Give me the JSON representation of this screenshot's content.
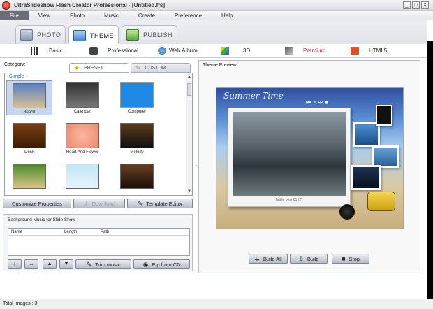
{
  "window": {
    "title": "UltraSlideshow Flash Creator Professional - [Untitled.ffs]",
    "controls": [
      "_",
      "□",
      "×"
    ]
  },
  "menu": [
    "File",
    "View",
    "Photo",
    "Music",
    "Create",
    "Preference",
    "Help"
  ],
  "main_tabs": [
    {
      "label": "Photo",
      "icon": "photo-icon",
      "active": false
    },
    {
      "label": "Theme",
      "icon": "theme-icon",
      "active": true
    },
    {
      "label": "Publish",
      "icon": "publish-icon",
      "active": false
    }
  ],
  "sub_tabs": [
    {
      "label": "Basic",
      "icon": "film-strip-icon"
    },
    {
      "label": "Professional",
      "icon": "camera-icon"
    },
    {
      "label": "Web Album",
      "icon": "globe-icon"
    },
    {
      "label": "3D",
      "icon": "cubes-icon"
    },
    {
      "label": "Premium",
      "icon": "premium-icon",
      "active": true
    },
    {
      "label": "HTML5",
      "icon": "html5-icon"
    }
  ],
  "left": {
    "category_label": "Category:",
    "preset_tab": "Preset",
    "custom_tab": "Custom",
    "group_label": "Simple",
    "themes": [
      {
        "label": "Beach",
        "selected": true
      },
      {
        "label": "Calendar"
      },
      {
        "label": "Computer"
      },
      {
        "label": "Desk"
      },
      {
        "label": "Heart And Flower"
      },
      {
        "label": "Melody"
      },
      {
        "label": ""
      },
      {
        "label": ""
      },
      {
        "label": ""
      }
    ],
    "customize_button": "Customize Properties",
    "download_button": "Download",
    "template_editor_button": "Template Editor"
  },
  "music": {
    "title": "Background Music for Slide Show",
    "columns": [
      "Name",
      "Length",
      "Path"
    ],
    "add": "+",
    "remove": "−",
    "up": "▲",
    "down": "▼",
    "trim_button": "Trim music",
    "rip_button": "Rip from CD"
  },
  "preview": {
    "label": "Theme Preview:",
    "caption": "battle pearl01 (2)",
    "overlay_title": "Summer Time"
  },
  "build": {
    "build_all": "Build All",
    "build": "Build",
    "stop": "Stop"
  },
  "status": {
    "text": "Total Images : 3"
  },
  "colors": {
    "active_subtab": "#c0192d",
    "menu_active_bg": "#6a6d78",
    "group_label": "#1d4fa8"
  }
}
